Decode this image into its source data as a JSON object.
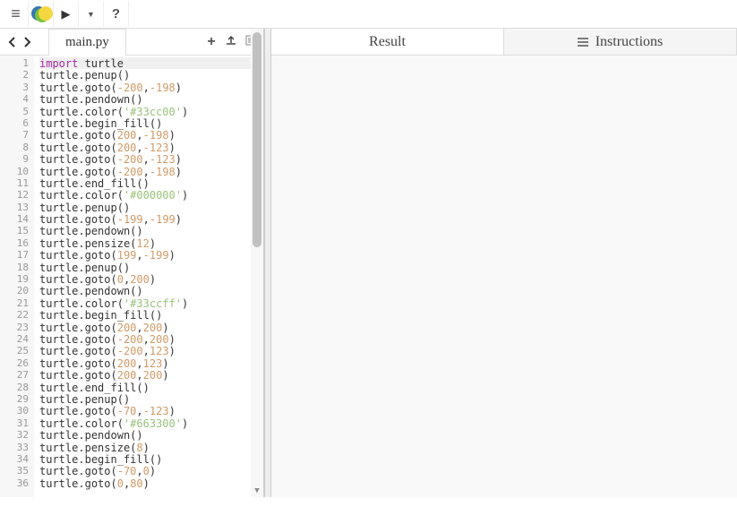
{
  "toolbar": {
    "menu": "≡",
    "run": "▶",
    "dropdown": "▼",
    "help": "?"
  },
  "nav": {
    "prev": "‹",
    "next": "›"
  },
  "tab": {
    "filename": "main.py"
  },
  "tabActions": {
    "add": "+",
    "upload": "↥",
    "download": "⇩"
  },
  "resultTabs": {
    "result": "Result",
    "instructions": "Instructions"
  },
  "code": {
    "lines": [
      {
        "n": 1,
        "tokens": [
          {
            "t": "import",
            "c": "import-kw"
          },
          {
            "t": " turtle",
            "c": ""
          }
        ]
      },
      {
        "n": 2,
        "tokens": [
          {
            "t": "turtle",
            "c": ""
          },
          {
            "t": ".",
            "c": "dot"
          },
          {
            "t": "penup",
            "c": "func"
          },
          {
            "t": "()",
            "c": "paren"
          }
        ]
      },
      {
        "n": 3,
        "tokens": [
          {
            "t": "turtle",
            "c": ""
          },
          {
            "t": ".",
            "c": "dot"
          },
          {
            "t": "goto",
            "c": "func"
          },
          {
            "t": "(",
            "c": "paren"
          },
          {
            "t": "-200",
            "c": "num"
          },
          {
            "t": ",",
            "c": ""
          },
          {
            "t": "-198",
            "c": "num"
          },
          {
            "t": ")",
            "c": "paren"
          }
        ]
      },
      {
        "n": 4,
        "tokens": [
          {
            "t": "turtle",
            "c": ""
          },
          {
            "t": ".",
            "c": "dot"
          },
          {
            "t": "pendown",
            "c": "func"
          },
          {
            "t": "()",
            "c": "paren"
          }
        ]
      },
      {
        "n": 5,
        "tokens": [
          {
            "t": "turtle",
            "c": ""
          },
          {
            "t": ".",
            "c": "dot"
          },
          {
            "t": "color",
            "c": "func"
          },
          {
            "t": "(",
            "c": "paren"
          },
          {
            "t": "'#33cc00'",
            "c": "str"
          },
          {
            "t": ")",
            "c": "paren"
          }
        ]
      },
      {
        "n": 6,
        "tokens": [
          {
            "t": "turtle",
            "c": ""
          },
          {
            "t": ".",
            "c": "dot"
          },
          {
            "t": "begin_fill",
            "c": "func"
          },
          {
            "t": "()",
            "c": "paren"
          }
        ]
      },
      {
        "n": 7,
        "tokens": [
          {
            "t": "turtle",
            "c": ""
          },
          {
            "t": ".",
            "c": "dot"
          },
          {
            "t": "goto",
            "c": "func"
          },
          {
            "t": "(",
            "c": "paren"
          },
          {
            "t": "200",
            "c": "num"
          },
          {
            "t": ",",
            "c": ""
          },
          {
            "t": "-198",
            "c": "num"
          },
          {
            "t": ")",
            "c": "paren"
          }
        ]
      },
      {
        "n": 8,
        "tokens": [
          {
            "t": "turtle",
            "c": ""
          },
          {
            "t": ".",
            "c": "dot"
          },
          {
            "t": "goto",
            "c": "func"
          },
          {
            "t": "(",
            "c": "paren"
          },
          {
            "t": "200",
            "c": "num"
          },
          {
            "t": ",",
            "c": ""
          },
          {
            "t": "-123",
            "c": "num"
          },
          {
            "t": ")",
            "c": "paren"
          }
        ]
      },
      {
        "n": 9,
        "tokens": [
          {
            "t": "turtle",
            "c": ""
          },
          {
            "t": ".",
            "c": "dot"
          },
          {
            "t": "goto",
            "c": "func"
          },
          {
            "t": "(",
            "c": "paren"
          },
          {
            "t": "-200",
            "c": "num"
          },
          {
            "t": ",",
            "c": ""
          },
          {
            "t": "-123",
            "c": "num"
          },
          {
            "t": ")",
            "c": "paren"
          }
        ]
      },
      {
        "n": 10,
        "tokens": [
          {
            "t": "turtle",
            "c": ""
          },
          {
            "t": ".",
            "c": "dot"
          },
          {
            "t": "goto",
            "c": "func"
          },
          {
            "t": "(",
            "c": "paren"
          },
          {
            "t": "-200",
            "c": "num"
          },
          {
            "t": ",",
            "c": ""
          },
          {
            "t": "-198",
            "c": "num"
          },
          {
            "t": ")",
            "c": "paren"
          }
        ]
      },
      {
        "n": 11,
        "tokens": [
          {
            "t": "turtle",
            "c": ""
          },
          {
            "t": ".",
            "c": "dot"
          },
          {
            "t": "end_fill",
            "c": "func"
          },
          {
            "t": "()",
            "c": "paren"
          }
        ]
      },
      {
        "n": 12,
        "tokens": [
          {
            "t": "turtle",
            "c": ""
          },
          {
            "t": ".",
            "c": "dot"
          },
          {
            "t": "color",
            "c": "func"
          },
          {
            "t": "(",
            "c": "paren"
          },
          {
            "t": "'#000000'",
            "c": "str"
          },
          {
            "t": ")",
            "c": "paren"
          }
        ]
      },
      {
        "n": 13,
        "tokens": [
          {
            "t": "turtle",
            "c": ""
          },
          {
            "t": ".",
            "c": "dot"
          },
          {
            "t": "penup",
            "c": "func"
          },
          {
            "t": "()",
            "c": "paren"
          }
        ]
      },
      {
        "n": 14,
        "tokens": [
          {
            "t": "turtle",
            "c": ""
          },
          {
            "t": ".",
            "c": "dot"
          },
          {
            "t": "goto",
            "c": "func"
          },
          {
            "t": "(",
            "c": "paren"
          },
          {
            "t": "-199",
            "c": "num"
          },
          {
            "t": ",",
            "c": ""
          },
          {
            "t": "-199",
            "c": "num"
          },
          {
            "t": ")",
            "c": "paren"
          }
        ]
      },
      {
        "n": 15,
        "tokens": [
          {
            "t": "turtle",
            "c": ""
          },
          {
            "t": ".",
            "c": "dot"
          },
          {
            "t": "pendown",
            "c": "func"
          },
          {
            "t": "()",
            "c": "paren"
          }
        ]
      },
      {
        "n": 16,
        "tokens": [
          {
            "t": "turtle",
            "c": ""
          },
          {
            "t": ".",
            "c": "dot"
          },
          {
            "t": "pensize",
            "c": "func"
          },
          {
            "t": "(",
            "c": "paren"
          },
          {
            "t": "12",
            "c": "num"
          },
          {
            "t": ")",
            "c": "paren"
          }
        ]
      },
      {
        "n": 17,
        "tokens": [
          {
            "t": "turtle",
            "c": ""
          },
          {
            "t": ".",
            "c": "dot"
          },
          {
            "t": "goto",
            "c": "func"
          },
          {
            "t": "(",
            "c": "paren"
          },
          {
            "t": "199",
            "c": "num"
          },
          {
            "t": ",",
            "c": ""
          },
          {
            "t": "-199",
            "c": "num"
          },
          {
            "t": ")",
            "c": "paren"
          }
        ]
      },
      {
        "n": 18,
        "tokens": [
          {
            "t": "turtle",
            "c": ""
          },
          {
            "t": ".",
            "c": "dot"
          },
          {
            "t": "penup",
            "c": "func"
          },
          {
            "t": "()",
            "c": "paren"
          }
        ]
      },
      {
        "n": 19,
        "tokens": [
          {
            "t": "turtle",
            "c": ""
          },
          {
            "t": ".",
            "c": "dot"
          },
          {
            "t": "goto",
            "c": "func"
          },
          {
            "t": "(",
            "c": "paren"
          },
          {
            "t": "0",
            "c": "num"
          },
          {
            "t": ",",
            "c": ""
          },
          {
            "t": "200",
            "c": "num"
          },
          {
            "t": ")",
            "c": "paren"
          }
        ]
      },
      {
        "n": 20,
        "tokens": [
          {
            "t": "turtle",
            "c": ""
          },
          {
            "t": ".",
            "c": "dot"
          },
          {
            "t": "pendown",
            "c": "func"
          },
          {
            "t": "()",
            "c": "paren"
          }
        ]
      },
      {
        "n": 21,
        "tokens": [
          {
            "t": "turtle",
            "c": ""
          },
          {
            "t": ".",
            "c": "dot"
          },
          {
            "t": "color",
            "c": "func"
          },
          {
            "t": "(",
            "c": "paren"
          },
          {
            "t": "'#33ccff'",
            "c": "str"
          },
          {
            "t": ")",
            "c": "paren"
          }
        ]
      },
      {
        "n": 22,
        "tokens": [
          {
            "t": "turtle",
            "c": ""
          },
          {
            "t": ".",
            "c": "dot"
          },
          {
            "t": "begin_fill",
            "c": "func"
          },
          {
            "t": "()",
            "c": "paren"
          }
        ]
      },
      {
        "n": 23,
        "tokens": [
          {
            "t": "turtle",
            "c": ""
          },
          {
            "t": ".",
            "c": "dot"
          },
          {
            "t": "goto",
            "c": "func"
          },
          {
            "t": "(",
            "c": "paren"
          },
          {
            "t": "200",
            "c": "num"
          },
          {
            "t": ",",
            "c": ""
          },
          {
            "t": "200",
            "c": "num"
          },
          {
            "t": ")",
            "c": "paren"
          }
        ]
      },
      {
        "n": 24,
        "tokens": [
          {
            "t": "turtle",
            "c": ""
          },
          {
            "t": ".",
            "c": "dot"
          },
          {
            "t": "goto",
            "c": "func"
          },
          {
            "t": "(",
            "c": "paren"
          },
          {
            "t": "-200",
            "c": "num"
          },
          {
            "t": ",",
            "c": ""
          },
          {
            "t": "200",
            "c": "num"
          },
          {
            "t": ")",
            "c": "paren"
          }
        ]
      },
      {
        "n": 25,
        "tokens": [
          {
            "t": "turtle",
            "c": ""
          },
          {
            "t": ".",
            "c": "dot"
          },
          {
            "t": "goto",
            "c": "func"
          },
          {
            "t": "(",
            "c": "paren"
          },
          {
            "t": "-200",
            "c": "num"
          },
          {
            "t": ",",
            "c": ""
          },
          {
            "t": "123",
            "c": "num"
          },
          {
            "t": ")",
            "c": "paren"
          }
        ]
      },
      {
        "n": 26,
        "tokens": [
          {
            "t": "turtle",
            "c": ""
          },
          {
            "t": ".",
            "c": "dot"
          },
          {
            "t": "goto",
            "c": "func"
          },
          {
            "t": "(",
            "c": "paren"
          },
          {
            "t": "200",
            "c": "num"
          },
          {
            "t": ",",
            "c": ""
          },
          {
            "t": "123",
            "c": "num"
          },
          {
            "t": ")",
            "c": "paren"
          }
        ]
      },
      {
        "n": 27,
        "tokens": [
          {
            "t": "turtle",
            "c": ""
          },
          {
            "t": ".",
            "c": "dot"
          },
          {
            "t": "goto",
            "c": "func"
          },
          {
            "t": "(",
            "c": "paren"
          },
          {
            "t": "200",
            "c": "num"
          },
          {
            "t": ",",
            "c": ""
          },
          {
            "t": "200",
            "c": "num"
          },
          {
            "t": ")",
            "c": "paren"
          }
        ]
      },
      {
        "n": 28,
        "tokens": [
          {
            "t": "turtle",
            "c": ""
          },
          {
            "t": ".",
            "c": "dot"
          },
          {
            "t": "end_fill",
            "c": "func"
          },
          {
            "t": "()",
            "c": "paren"
          }
        ]
      },
      {
        "n": 29,
        "tokens": [
          {
            "t": "turtle",
            "c": ""
          },
          {
            "t": ".",
            "c": "dot"
          },
          {
            "t": "penup",
            "c": "func"
          },
          {
            "t": "()",
            "c": "paren"
          }
        ]
      },
      {
        "n": 30,
        "tokens": [
          {
            "t": "turtle",
            "c": ""
          },
          {
            "t": ".",
            "c": "dot"
          },
          {
            "t": "goto",
            "c": "func"
          },
          {
            "t": "(",
            "c": "paren"
          },
          {
            "t": "-70",
            "c": "num"
          },
          {
            "t": ",",
            "c": ""
          },
          {
            "t": "-123",
            "c": "num"
          },
          {
            "t": ")",
            "c": "paren"
          }
        ]
      },
      {
        "n": 31,
        "tokens": [
          {
            "t": "turtle",
            "c": ""
          },
          {
            "t": ".",
            "c": "dot"
          },
          {
            "t": "color",
            "c": "func"
          },
          {
            "t": "(",
            "c": "paren"
          },
          {
            "t": "'#663300'",
            "c": "str"
          },
          {
            "t": ")",
            "c": "paren"
          }
        ]
      },
      {
        "n": 32,
        "tokens": [
          {
            "t": "turtle",
            "c": ""
          },
          {
            "t": ".",
            "c": "dot"
          },
          {
            "t": "pendown",
            "c": "func"
          },
          {
            "t": "()",
            "c": "paren"
          }
        ]
      },
      {
        "n": 33,
        "tokens": [
          {
            "t": "turtle",
            "c": ""
          },
          {
            "t": ".",
            "c": "dot"
          },
          {
            "t": "pensize",
            "c": "func"
          },
          {
            "t": "(",
            "c": "paren"
          },
          {
            "t": "8",
            "c": "num"
          },
          {
            "t": ")",
            "c": "paren"
          }
        ]
      },
      {
        "n": 34,
        "tokens": [
          {
            "t": "turtle",
            "c": ""
          },
          {
            "t": ".",
            "c": "dot"
          },
          {
            "t": "begin_fill",
            "c": "func"
          },
          {
            "t": "()",
            "c": "paren"
          }
        ]
      },
      {
        "n": 35,
        "tokens": [
          {
            "t": "turtle",
            "c": ""
          },
          {
            "t": ".",
            "c": "dot"
          },
          {
            "t": "goto",
            "c": "func"
          },
          {
            "t": "(",
            "c": "paren"
          },
          {
            "t": "-70",
            "c": "num"
          },
          {
            "t": ",",
            "c": ""
          },
          {
            "t": "0",
            "c": "num"
          },
          {
            "t": ")",
            "c": "paren"
          }
        ]
      },
      {
        "n": 36,
        "tokens": [
          {
            "t": "turtle",
            "c": ""
          },
          {
            "t": ".",
            "c": "dot"
          },
          {
            "t": "goto",
            "c": "func"
          },
          {
            "t": "(",
            "c": "paren"
          },
          {
            "t": "0",
            "c": "num"
          },
          {
            "t": ",",
            "c": ""
          },
          {
            "t": "80",
            "c": "num"
          },
          {
            "t": ")",
            "c": "paren"
          }
        ]
      }
    ]
  }
}
